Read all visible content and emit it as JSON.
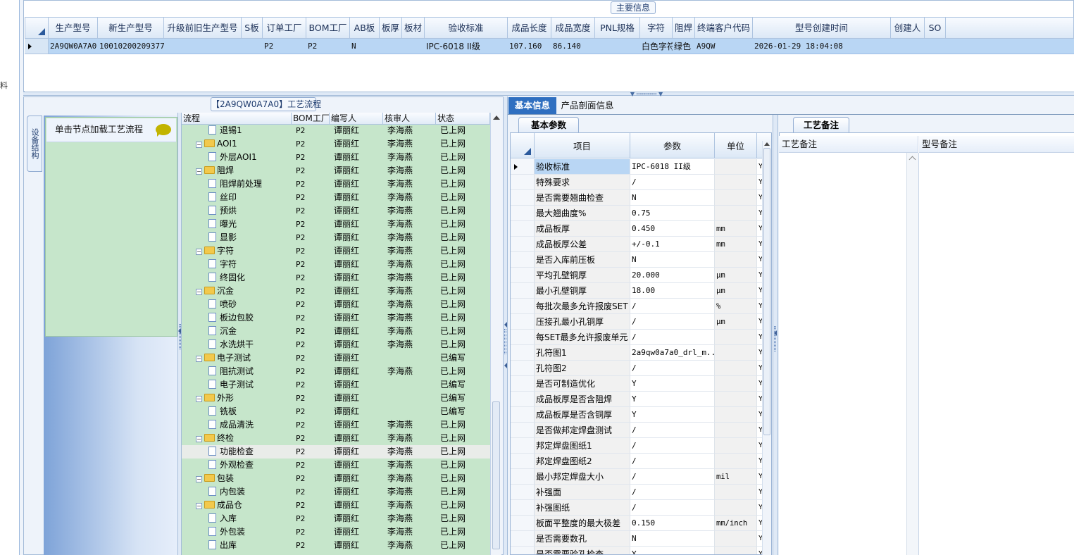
{
  "left_strip": {
    "char": "料"
  },
  "main_info": {
    "title": "主要信息",
    "columns": [
      "生产型号",
      "新生产型号",
      "升级前旧生产型号",
      "S板",
      "订单工厂",
      "BOM工厂",
      "AB板",
      "板厚",
      "板材",
      "验收标准",
      "成品长度",
      "成品宽度",
      "PNL规格",
      "字符",
      "阻焊",
      "终端客户代码",
      "型号创建时间",
      "创建人",
      "SO"
    ],
    "row": [
      "2A9QW0A7A0",
      "10010200209377",
      "",
      "",
      "P2",
      "P2",
      "N",
      "",
      "",
      "IPC-6018 II级",
      "107.160",
      "86.140",
      "",
      "白色字符",
      "绿色",
      "A9QW",
      "2026-01-29 18:04:08",
      "",
      ""
    ]
  },
  "process": {
    "title": "【2A9QW0A7A0】工艺流程",
    "side_tab": "设备结构",
    "load_hint": "单击节点加载工艺流程",
    "columns": [
      "流程",
      "BOM工厂",
      "编写人",
      "核审人",
      "状态"
    ],
    "rows": [
      {
        "type": "leaf",
        "name": "退锡1",
        "bom": "P2",
        "writer": "谭丽红",
        "reviewer": "李海燕",
        "status": "已上网"
      },
      {
        "type": "group",
        "name": "AOI1",
        "bom": "P2",
        "writer": "谭丽红",
        "reviewer": "李海燕",
        "status": "已上网"
      },
      {
        "type": "leaf",
        "name": "外层AOI1",
        "bom": "P2",
        "writer": "谭丽红",
        "reviewer": "李海燕",
        "status": "已上网"
      },
      {
        "type": "group",
        "name": "阻焊",
        "bom": "P2",
        "writer": "谭丽红",
        "reviewer": "李海燕",
        "status": "已上网"
      },
      {
        "type": "leaf",
        "name": "阻焊前处理",
        "bom": "P2",
        "writer": "谭丽红",
        "reviewer": "李海燕",
        "status": "已上网"
      },
      {
        "type": "leaf",
        "name": "丝印",
        "bom": "P2",
        "writer": "谭丽红",
        "reviewer": "李海燕",
        "status": "已上网"
      },
      {
        "type": "leaf",
        "name": "预烘",
        "bom": "P2",
        "writer": "谭丽红",
        "reviewer": "李海燕",
        "status": "已上网"
      },
      {
        "type": "leaf",
        "name": "曝光",
        "bom": "P2",
        "writer": "谭丽红",
        "reviewer": "李海燕",
        "status": "已上网"
      },
      {
        "type": "leaf",
        "name": "显影",
        "bom": "P2",
        "writer": "谭丽红",
        "reviewer": "李海燕",
        "status": "已上网"
      },
      {
        "type": "group",
        "name": "字符",
        "bom": "P2",
        "writer": "谭丽红",
        "reviewer": "李海燕",
        "status": "已上网"
      },
      {
        "type": "leaf",
        "name": "字符",
        "bom": "P2",
        "writer": "谭丽红",
        "reviewer": "李海燕",
        "status": "已上网"
      },
      {
        "type": "leaf",
        "name": "终固化",
        "bom": "P2",
        "writer": "谭丽红",
        "reviewer": "李海燕",
        "status": "已上网"
      },
      {
        "type": "group",
        "name": "沉金",
        "bom": "P2",
        "writer": "谭丽红",
        "reviewer": "李海燕",
        "status": "已上网"
      },
      {
        "type": "leaf",
        "name": "喷砂",
        "bom": "P2",
        "writer": "谭丽红",
        "reviewer": "李海燕",
        "status": "已上网"
      },
      {
        "type": "leaf",
        "name": "板边包胶",
        "bom": "P2",
        "writer": "谭丽红",
        "reviewer": "李海燕",
        "status": "已上网"
      },
      {
        "type": "leaf",
        "name": "沉金",
        "bom": "P2",
        "writer": "谭丽红",
        "reviewer": "李海燕",
        "status": "已上网"
      },
      {
        "type": "leaf",
        "name": "水洗烘干",
        "bom": "P2",
        "writer": "谭丽红",
        "reviewer": "李海燕",
        "status": "已上网"
      },
      {
        "type": "group",
        "name": "电子测试",
        "bom": "P2",
        "writer": "谭丽红",
        "reviewer": "",
        "status": "已编写"
      },
      {
        "type": "leaf",
        "name": "阻抗测试",
        "bom": "P2",
        "writer": "谭丽红",
        "reviewer": "李海燕",
        "status": "已上网"
      },
      {
        "type": "leaf",
        "name": "电子测试",
        "bom": "P2",
        "writer": "谭丽红",
        "reviewer": "",
        "status": "已编写"
      },
      {
        "type": "group",
        "name": "外形",
        "bom": "P2",
        "writer": "谭丽红",
        "reviewer": "",
        "status": "已编写"
      },
      {
        "type": "leaf",
        "name": "铣板",
        "bom": "P2",
        "writer": "谭丽红",
        "reviewer": "",
        "status": "已编写"
      },
      {
        "type": "leaf",
        "name": "成品清洗",
        "bom": "P2",
        "writer": "谭丽红",
        "reviewer": "李海燕",
        "status": "已上网"
      },
      {
        "type": "group",
        "name": "终检",
        "bom": "P2",
        "writer": "谭丽红",
        "reviewer": "李海燕",
        "status": "已上网"
      },
      {
        "type": "leaf",
        "name": "功能检查",
        "bom": "P2",
        "writer": "谭丽红",
        "reviewer": "李海燕",
        "status": "已上网",
        "highlight": true
      },
      {
        "type": "leaf",
        "name": "外观检查",
        "bom": "P2",
        "writer": "谭丽红",
        "reviewer": "李海燕",
        "status": "已上网"
      },
      {
        "type": "group",
        "name": "包装",
        "bom": "P2",
        "writer": "谭丽红",
        "reviewer": "李海燕",
        "status": "已上网"
      },
      {
        "type": "leaf",
        "name": "内包装",
        "bom": "P2",
        "writer": "谭丽红",
        "reviewer": "李海燕",
        "status": "已上网"
      },
      {
        "type": "group",
        "name": "成品仓",
        "bom": "P2",
        "writer": "谭丽红",
        "reviewer": "李海燕",
        "status": "已上网"
      },
      {
        "type": "leaf",
        "name": "入库",
        "bom": "P2",
        "writer": "谭丽红",
        "reviewer": "李海燕",
        "status": "已上网"
      },
      {
        "type": "leaf",
        "name": "外包装",
        "bom": "P2",
        "writer": "谭丽红",
        "reviewer": "李海燕",
        "status": "已上网"
      },
      {
        "type": "leaf",
        "name": "出库",
        "bom": "P2",
        "writer": "谭丽红",
        "reviewer": "李海燕",
        "status": "已上网"
      }
    ]
  },
  "tabs": {
    "basic": "基本信息",
    "profile": "产品剖面信息"
  },
  "basic_params": {
    "tab": "基本参数",
    "columns": [
      "项目",
      "参数",
      "单位"
    ],
    "rows": [
      {
        "k": "验收标准",
        "v": "IPC-6018 II级",
        "u": "",
        "f": "Y",
        "sel": true
      },
      {
        "k": "特殊要求",
        "v": "/",
        "u": "",
        "f": "Y"
      },
      {
        "k": "是否需要翘曲检查",
        "v": "N",
        "u": "",
        "f": "Y"
      },
      {
        "k": "最大翘曲度%",
        "v": "0.75",
        "u": "",
        "f": "Y"
      },
      {
        "k": "成品板厚",
        "v": "0.450",
        "u": "mm",
        "f": "Y"
      },
      {
        "k": "成品板厚公差",
        "v": "+/-0.1",
        "u": "mm",
        "f": "Y"
      },
      {
        "k": "是否入库前压板",
        "v": "N",
        "u": "",
        "f": "Y"
      },
      {
        "k": "平均孔壁铜厚",
        "v": "20.000",
        "u": "μm",
        "f": "Y"
      },
      {
        "k": "最小孔壁铜厚",
        "v": "18.00",
        "u": "μm",
        "f": "Y"
      },
      {
        "k": "每批次最多允许报废SET",
        "v": "/",
        "u": "%",
        "f": "Y"
      },
      {
        "k": "压接孔最小孔铜厚",
        "v": "/",
        "u": "μm",
        "f": "Y"
      },
      {
        "k": "每SET最多允许报废单元",
        "v": "/",
        "u": "",
        "f": "Y"
      },
      {
        "k": "孔符图1",
        "v": "2a9qw0a7a0_drl_m...",
        "u": "",
        "f": "Y"
      },
      {
        "k": "孔符图2",
        "v": "/",
        "u": "",
        "f": "Y"
      },
      {
        "k": "是否可制造优化",
        "v": "Y",
        "u": "",
        "f": "Y"
      },
      {
        "k": "成品板厚是否含阻焊",
        "v": "Y",
        "u": "",
        "f": "Y"
      },
      {
        "k": "成品板厚是否含铜厚",
        "v": "Y",
        "u": "",
        "f": "Y"
      },
      {
        "k": "是否做邦定焊盘测试",
        "v": "/",
        "u": "",
        "f": "Y"
      },
      {
        "k": "邦定焊盘图纸1",
        "v": "/",
        "u": "",
        "f": "Y"
      },
      {
        "k": "邦定焊盘图纸2",
        "v": "/",
        "u": "",
        "f": "Y"
      },
      {
        "k": "最小邦定焊盘大小",
        "v": "/",
        "u": "mil",
        "f": "Y"
      },
      {
        "k": "补强面",
        "v": "/",
        "u": "",
        "f": "Y"
      },
      {
        "k": "补强图纸",
        "v": "/",
        "u": "",
        "f": "Y"
      },
      {
        "k": "板面平整度的最大极差",
        "v": "0.150",
        "u": "mm/inch",
        "f": "Y"
      },
      {
        "k": "是否需要数孔",
        "v": "N",
        "u": "",
        "f": "Y"
      },
      {
        "k": "是否需要验孔检查",
        "v": "Y",
        "u": "",
        "f": "Y"
      }
    ]
  },
  "notes": {
    "tab": "工艺备注",
    "process_note": "工艺备注",
    "model_note": "型号备注"
  }
}
